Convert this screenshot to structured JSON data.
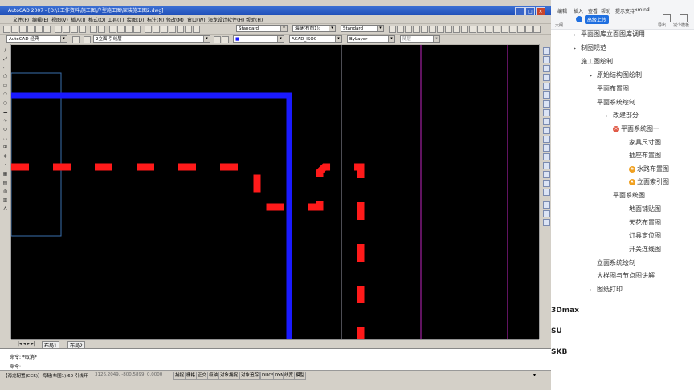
{
  "acad": {
    "title": "AutoCAD 2007 - [D:\\1工作资料\\施工图\\户型施工图\\家装施工图2.dwg]",
    "menu": [
      "文件(F)",
      "编辑(E)",
      "视图(V)",
      "插入(I)",
      "格式(O)",
      "工具(T)",
      "绘图(D)",
      "标注(N)",
      "修改(M)",
      "窗口(W)",
      "海龙设计软件(H)",
      "帮助(H)"
    ],
    "workspace": "AutoCAD 经典",
    "layer": "2立面 引线层",
    "color": "■",
    "linetype": "ACAD_ISO0",
    "lineweight": "ByLayer",
    "plotstyle": "随层",
    "textstyle": "Standard",
    "dimstyle": "海醚(布图1):",
    "tablestyle": "Standard",
    "tabs": [
      "布局1",
      "布局2"
    ],
    "cmd_lines": [
      "命令: *取消*",
      "命令:"
    ],
    "status_left": "【海龙配置(CCS)】海醚(布图1):60 引线开",
    "coords": "3126.2049, -800.5899, 0.0000",
    "status_buttons": [
      "捕捉",
      "栅格",
      "正交",
      "极轴",
      "对象捕捉",
      "对象追踪",
      "DUCS",
      "DYN",
      "线宽",
      "模型"
    ]
  },
  "mindmap": {
    "menu": [
      "编辑",
      "插入",
      "查看",
      "帮助",
      "提示支持",
      "xmind"
    ],
    "button": "高级上传",
    "tools": [
      "大纲",
      "导出",
      "减少模板"
    ],
    "nodes": [
      "平面图库立面图库调用",
      "制图规范",
      "施工图绘制",
      "原始结构图绘制",
      "平面布置图",
      "平面系统绘制",
      "改建部分",
      "平面系统图一",
      "家具尺寸图",
      "插座布置图",
      "水路布置图",
      "立面索引图",
      "平面系统图二",
      "地面铺贴图",
      "天花布置图",
      "灯具定位图",
      "开关连线图",
      "立面系统绘制",
      "大样图与节点图讲解",
      "图纸打印"
    ],
    "side_labels": [
      "3Dmax",
      "SU",
      "SKB"
    ],
    "colors": {
      "red_badge": "#e05a47",
      "orange_badge": "#f0a020"
    }
  },
  "drawing": {
    "colors": {
      "blue": "#1a1aff",
      "red": "#ff1a1a",
      "magenta": "#a020a0",
      "gray": "#9a9aa8",
      "steel": "#3a6fae"
    }
  }
}
